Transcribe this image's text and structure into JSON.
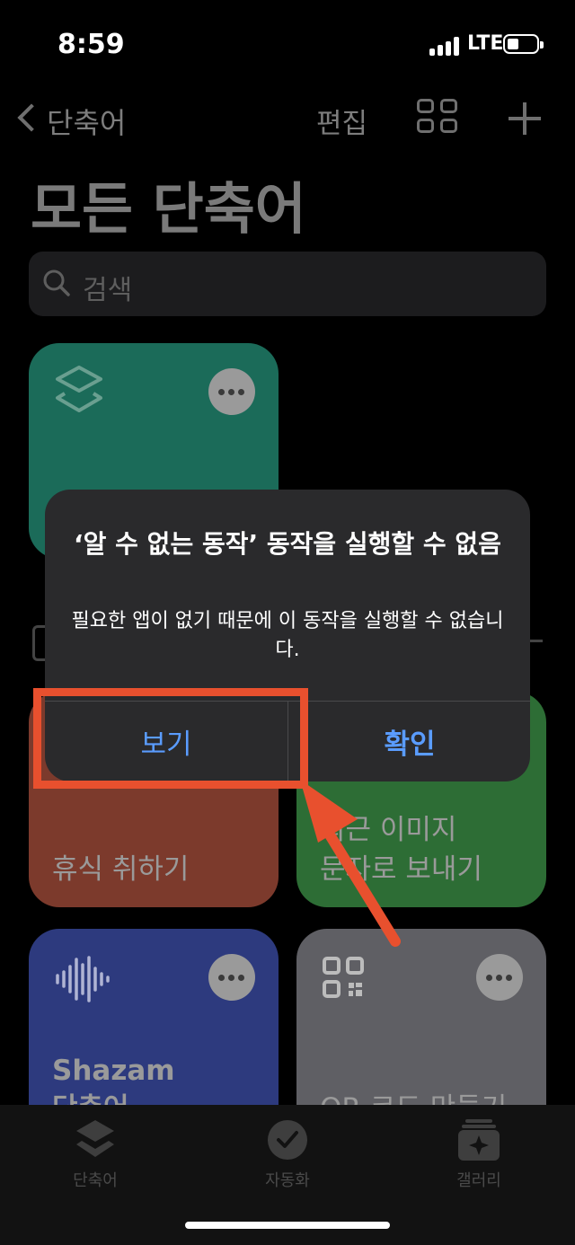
{
  "status_bar": {
    "time": "8:59",
    "network": "LTE"
  },
  "nav": {
    "back_label": "단축어",
    "edit_label": "편집"
  },
  "page_title": "모든 단축어",
  "search": {
    "placeholder": "검색"
  },
  "cards": {
    "rest": "휴식 취하기",
    "recent_images_line1": "최근 이미지",
    "recent_images_line2": "문자로 보내기",
    "shazam_line1": "Shazam",
    "shazam_line2": "단축어",
    "qr": "QR 코드 만들기"
  },
  "tabs": [
    {
      "label": "단축어"
    },
    {
      "label": "자동화"
    },
    {
      "label": "갤러리"
    }
  ],
  "alert": {
    "title": "‘알 수 없는 동작’ 동작을 실행할 수 없음",
    "message": "필요한 앱이 없기 때문에 이 동작을 실행할 수 없습니다.",
    "view_button": "보기",
    "confirm_button": "확인"
  },
  "colors": {
    "accent": "#5a9cff",
    "annotation": "#e8502e",
    "card_teal": "#1b6b59",
    "card_red": "#7c3a2c",
    "card_green": "#2d6d35",
    "card_blue": "#2d3a7e",
    "card_gray": "#5f5f64"
  }
}
